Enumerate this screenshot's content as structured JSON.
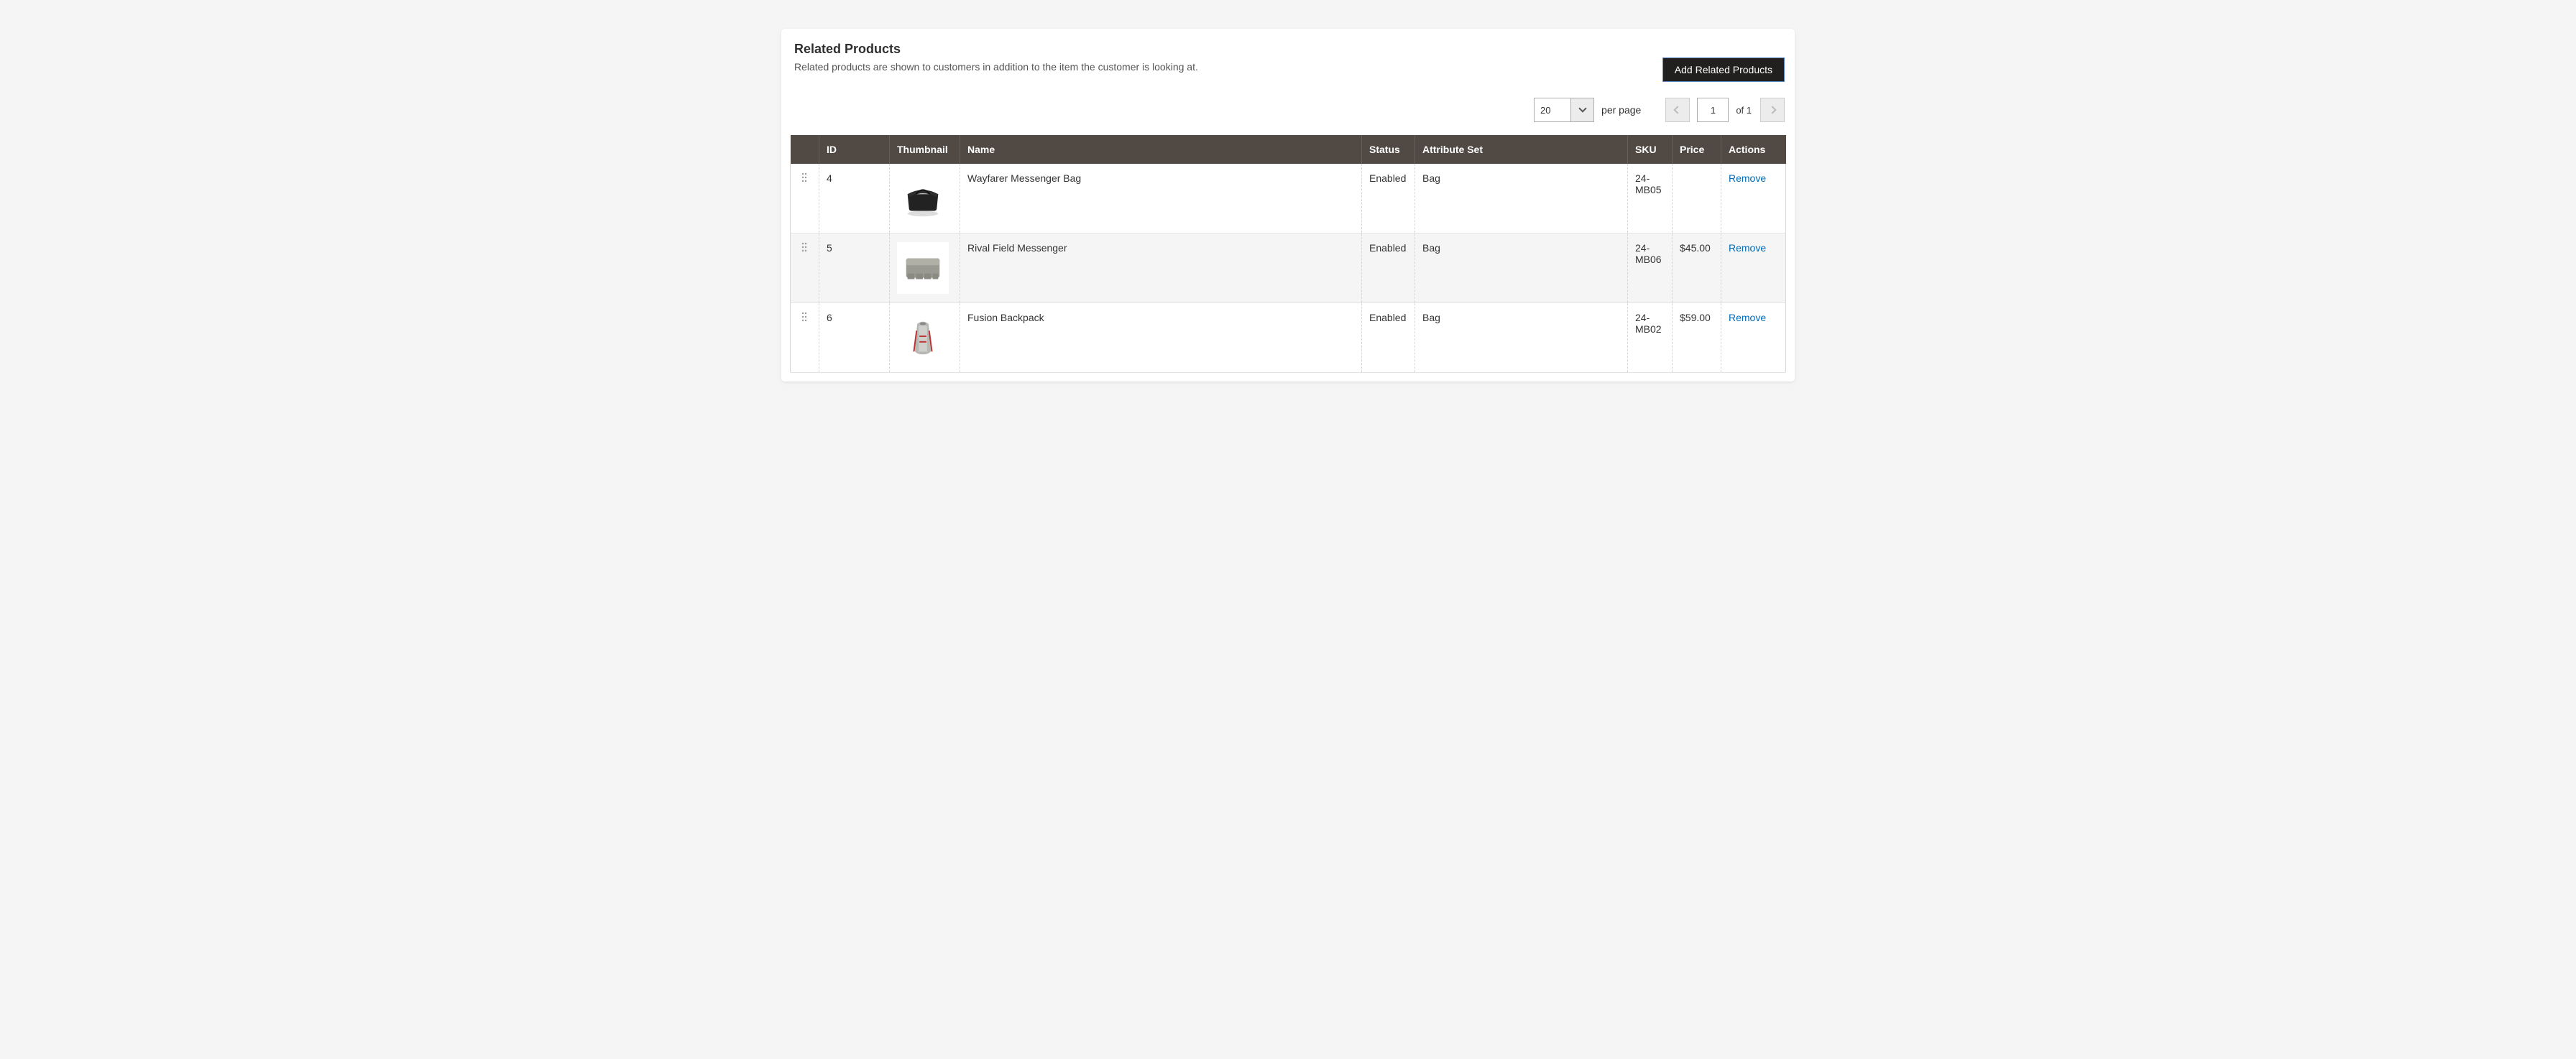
{
  "panel": {
    "title": "Related Products",
    "subtitle": "Related products are shown to customers in addition to the item the customer is looking at.",
    "add_button": "Add Related Products"
  },
  "pager": {
    "page_size": "20",
    "per_page_label": "per page",
    "current_page": "1",
    "of_label": "of 1"
  },
  "columns": {
    "handle": "",
    "id": "ID",
    "thumbnail": "Thumbnail",
    "name": "Name",
    "status": "Status",
    "attribute_set": "Attribute Set",
    "sku": "SKU",
    "price": "Price",
    "actions": "Actions"
  },
  "action_labels": {
    "remove": "Remove"
  },
  "rows": [
    {
      "id": "4",
      "name": "Wayfarer Messenger Bag",
      "status": "Enabled",
      "attribute_set": "Bag",
      "sku": "24-MB05",
      "price": ""
    },
    {
      "id": "5",
      "name": "Rival Field Messenger",
      "status": "Enabled",
      "attribute_set": "Bag",
      "sku": "24-MB06",
      "price": "$45.00"
    },
    {
      "id": "6",
      "name": "Fusion Backpack",
      "status": "Enabled",
      "attribute_set": "Bag",
      "sku": "24-MB02",
      "price": "$59.00"
    }
  ]
}
